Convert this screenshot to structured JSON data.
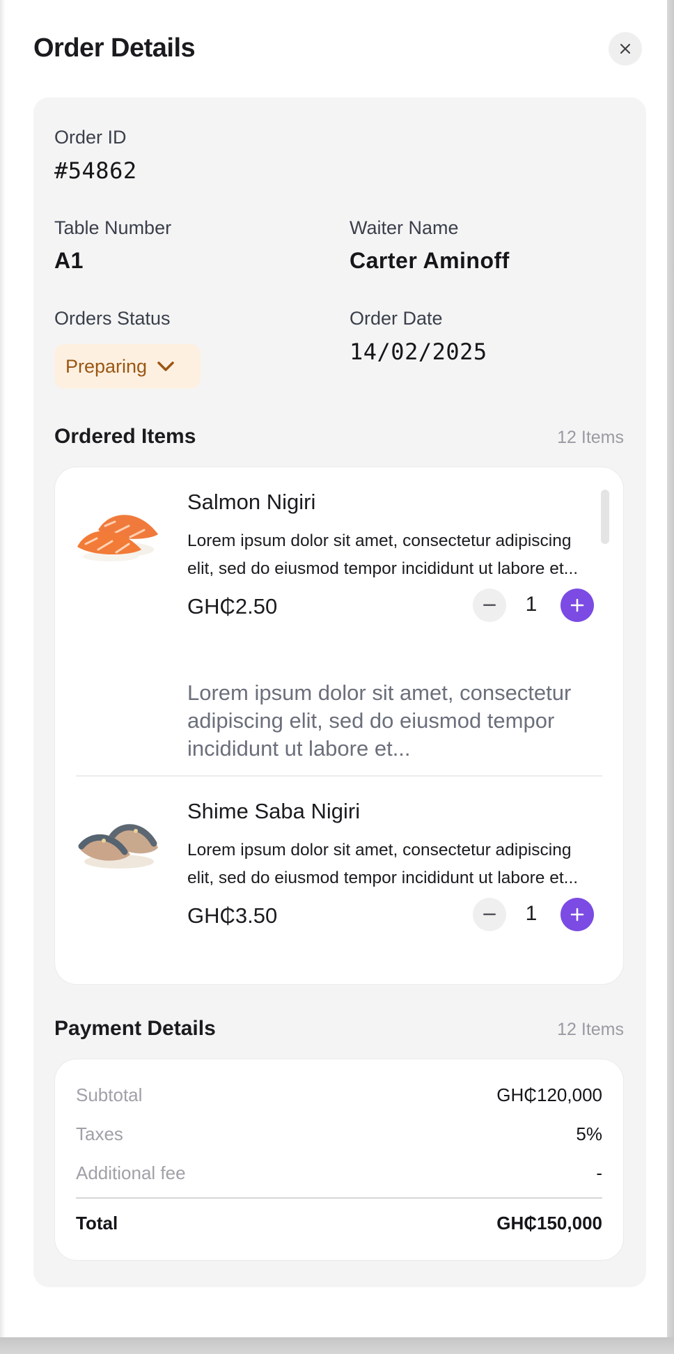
{
  "header": {
    "title": "Order Details",
    "close_icon": "close-icon"
  },
  "order": {
    "id_label": "Order ID",
    "id_value": "#54862",
    "table_label": "Table Number",
    "table_value": "A1",
    "waiter_label": "Waiter Name",
    "waiter_value": "Carter Aminoff",
    "status_label": "Orders Status",
    "status_value": "Preparing",
    "status_icon": "chevron-down-icon",
    "date_label": "Order Date",
    "date_value": "14/02/2025"
  },
  "ordered_items": {
    "title": "Ordered Items",
    "count": "12 Items",
    "items": [
      {
        "name": "Salmon Nigiri",
        "description": "Lorem ipsum dolor sit amet, consectetur adipiscing elit, sed do eiusmod tempor incididunt ut labore et...",
        "price": "GH₵2.50",
        "quantity": "1",
        "note": "Lorem ipsum dolor sit amet, consectetur adipiscing elit, sed do eiusmod tempor incididunt ut labore et..."
      },
      {
        "name": "Shime Saba Nigiri",
        "description": "Lorem ipsum dolor sit amet, consectetur adipiscing elit, sed do eiusmod tempor incididunt ut labore et...",
        "price": "GH₵3.50",
        "quantity": "1"
      }
    ]
  },
  "payment": {
    "title": "Payment Details",
    "count": "12 Items",
    "subtotal_label": "Subtotal",
    "subtotal_value": "GH₵120,000",
    "taxes_label": "Taxes",
    "taxes_value": "5%",
    "fee_label": "Additional fee",
    "fee_value": "-",
    "total_label": "Total",
    "total_value": "GH₵150,000"
  },
  "colors": {
    "accent": "#7B4BE3",
    "status_bg": "#FDF0E1",
    "status_text": "#9A5613",
    "card_bg": "#F4F4F4"
  }
}
